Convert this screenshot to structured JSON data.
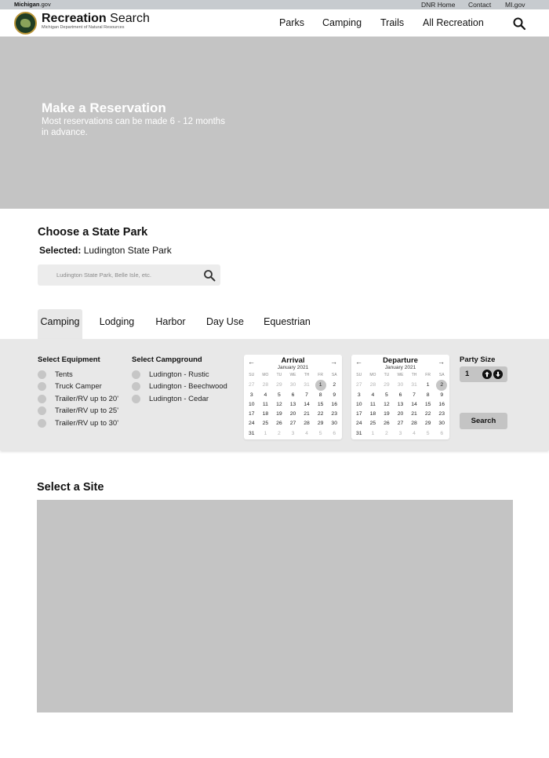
{
  "utility": {
    "gov_name": "Michigan",
    "gov_suffix": ".gov",
    "links": [
      "DNR Home",
      "Contact",
      "MI.gov"
    ]
  },
  "header": {
    "brand_bold": "Recreation",
    "brand_light": " Search",
    "brand_subtitle": "Michigan Department of Natural Resources",
    "nav": [
      "Parks",
      "Camping",
      "Trails",
      "All Recreation"
    ]
  },
  "hero": {
    "title": "Make a Reservation",
    "subtitle": "Most reservations can be made 6 - 12 months in advance."
  },
  "park_chooser": {
    "heading": "Choose a State Park",
    "selected_label": "Selected:",
    "selected_value": " Ludington State Park",
    "search_placeholder": "Ludington State Park, Belle Isle, etc."
  },
  "tabs": [
    "Camping",
    "Lodging",
    "Harbor",
    "Day Use",
    "Equestrian"
  ],
  "active_tab": "Camping",
  "booking": {
    "equipment_title": "Select Equipment",
    "equipment": [
      "Tents",
      "Truck Camper",
      "Trailer/RV up to 20'",
      "Trailer/RV up to 25'",
      "Trailer/RV up to 30'"
    ],
    "campground_title": "Select Campground",
    "campgrounds": [
      "Ludington - Rustic",
      "Ludington - Beechwood",
      "Ludington - Cedar"
    ],
    "weekdays": [
      "SU",
      "MO",
      "TU",
      "WE",
      "TH",
      "FR",
      "SA"
    ],
    "arrival": {
      "title": "Arrival",
      "month": "January 2021",
      "days": [
        "27",
        "28",
        "29",
        "30",
        "31",
        "1",
        "2",
        "3",
        "4",
        "5",
        "6",
        "7",
        "8",
        "9",
        "10",
        "11",
        "12",
        "13",
        "14",
        "15",
        "16",
        "17",
        "18",
        "19",
        "20",
        "21",
        "22",
        "23",
        "24",
        "25",
        "26",
        "27",
        "28",
        "29",
        "30",
        "31",
        "1",
        "2",
        "3",
        "4",
        "5",
        "6"
      ],
      "muted": [
        0,
        1,
        2,
        3,
        4,
        36,
        37,
        38,
        39,
        40,
        41
      ],
      "selected": 5
    },
    "departure": {
      "title": "Departure",
      "month": "January 2021",
      "days": [
        "27",
        "28",
        "29",
        "30",
        "31",
        "1",
        "2",
        "3",
        "4",
        "5",
        "6",
        "7",
        "8",
        "9",
        "10",
        "11",
        "12",
        "13",
        "14",
        "15",
        "16",
        "17",
        "18",
        "19",
        "20",
        "21",
        "22",
        "23",
        "24",
        "25",
        "26",
        "27",
        "28",
        "29",
        "30",
        "31",
        "1",
        "2",
        "3",
        "4",
        "5",
        "6"
      ],
      "muted": [
        0,
        1,
        2,
        3,
        4,
        36,
        37,
        38,
        39,
        40,
        41
      ],
      "selected": 6
    },
    "party_size_label": "Party Size",
    "party_size_value": "1",
    "search_label": "Search"
  },
  "site": {
    "heading": "Select a Site"
  }
}
